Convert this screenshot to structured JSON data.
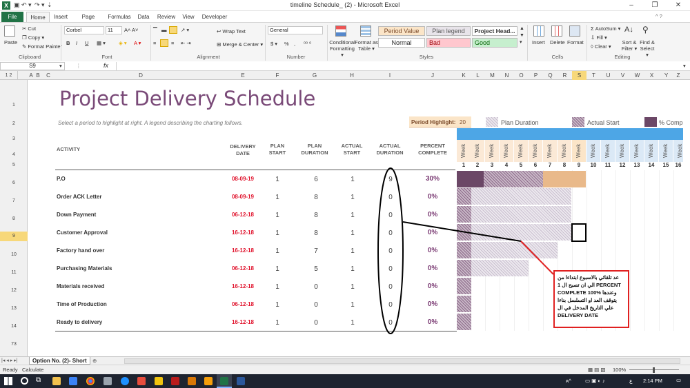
{
  "window": {
    "title": "timeline Schedule_ (2)  -  Microsoft Excel",
    "app_logo": "X",
    "controls": [
      "–",
      "❐",
      "✕"
    ],
    "ribbon_min": "^ ?"
  },
  "tabs": [
    "File",
    "Home",
    "Insert",
    "Page Layout",
    "Formulas",
    "Data",
    "Review",
    "View",
    "Developer"
  ],
  "ribbon": {
    "clipboard": {
      "paste": "Paste",
      "cut": "Cut",
      "copy": "Copy ▾",
      "format_painter": "Format Painter",
      "group": "Clipboard"
    },
    "font": {
      "name": "Corbel",
      "size": "11",
      "bold": "B",
      "italic": "I",
      "underline": "U",
      "group": "Font"
    },
    "alignment": {
      "wrap": "Wrap Text",
      "merge": "Merge & Center ▾",
      "group": "Alignment"
    },
    "number": {
      "format": "General",
      "currency": "$ ▾",
      "percent": "%",
      "comma": ",",
      "group": "Number"
    },
    "styles": {
      "conditional": "Conditional Formatting ▾",
      "format_table": "Format as Table ▾",
      "cells": [
        "Period Value",
        "Plan legend",
        "Project Head...",
        "Normal",
        "Bad",
        "Good"
      ],
      "group": "Styles"
    },
    "cells": {
      "insert": "Insert",
      "delete": "Delete",
      "format": "Format",
      "group": "Cells"
    },
    "editing": {
      "autosum": "AutoSum ▾",
      "fill": "Fill ▾",
      "clear": "Clear ▾",
      "sort": "Sort & Filter ▾",
      "find": "Find & Select ▾",
      "group": "Editing"
    }
  },
  "formula_bar": {
    "name_box": "S9",
    "fx": "fx",
    "content": ""
  },
  "columns": [
    "A",
    "B",
    "C",
    "D",
    "E",
    "F",
    "G",
    "H",
    "I",
    "J",
    "K",
    "L",
    "M",
    "N",
    "O",
    "P",
    "Q",
    "R",
    "S",
    "T",
    "U",
    "V",
    "W",
    "X",
    "Y",
    "Z"
  ],
  "outline_levels": [
    "1",
    "2"
  ],
  "rows": [
    "1",
    "2",
    "3",
    "4",
    "5",
    "6",
    "7",
    "8",
    "9",
    "10",
    "11",
    "12",
    "13",
    "14",
    "73"
  ],
  "sheet": {
    "title": "Project Delivery Schedule",
    "subtitle": "Select a period to highlight at right.  A legend describing the charting follows.",
    "period_highlight_label": "Period Highlight:",
    "period_highlight_value": "20",
    "legend": [
      "Plan Duration",
      "Actual Start",
      "% Comp"
    ],
    "headers": {
      "activity": "ACTIVITY",
      "delivery_date": "DELIVERY DATE",
      "plan_start": "PLAN START",
      "plan_duration": "PLAN DURATION",
      "actual_start": "ACTUAL START",
      "actual_duration": "ACTUAL DURATION",
      "percent_complete": "PERCENT COMPLETE"
    },
    "week_label": "Week",
    "weeks": [
      "1",
      "2",
      "3",
      "4",
      "5",
      "6",
      "7",
      "8",
      "9",
      "10",
      "11",
      "12",
      "13",
      "14",
      "15",
      "16"
    ],
    "rows": [
      {
        "activity": "P.O",
        "date": "08-09-19",
        "plan_start": "1",
        "plan_duration": "6",
        "actual_start": "1",
        "actual_duration": "9",
        "percent": "30%"
      },
      {
        "activity": "Order ACK Letter",
        "date": "08-09-19",
        "plan_start": "1",
        "plan_duration": "8",
        "actual_start": "1",
        "actual_duration": "0",
        "percent": "0%"
      },
      {
        "activity": "Down Payment",
        "date": "06-12-18",
        "plan_start": "1",
        "plan_duration": "8",
        "actual_start": "1",
        "actual_duration": "0",
        "percent": "0%"
      },
      {
        "activity": "Customer Approval",
        "date": "16-12-18",
        "plan_start": "1",
        "plan_duration": "8",
        "actual_start": "1",
        "actual_duration": "0",
        "percent": "0%"
      },
      {
        "activity": "Factory hand over",
        "date": "16-12-18",
        "plan_start": "1",
        "plan_duration": "7",
        "actual_start": "1",
        "actual_duration": "0",
        "percent": "0%"
      },
      {
        "activity": "Purchasing Materials",
        "date": "06-12-18",
        "plan_start": "1",
        "plan_duration": "5",
        "actual_start": "1",
        "actual_duration": "0",
        "percent": "0%"
      },
      {
        "activity": "Materials received",
        "date": "16-12-18",
        "plan_start": "1",
        "plan_duration": "0",
        "actual_start": "1",
        "actual_duration": "0",
        "percent": "0%"
      },
      {
        "activity": "Time of Production",
        "date": "06-12-18",
        "plan_start": "1",
        "plan_duration": "0",
        "actual_start": "1",
        "actual_duration": "0",
        "percent": "0%"
      },
      {
        "activity": "Ready to delivery",
        "date": "16-12-18",
        "plan_start": "1",
        "plan_duration": "0",
        "actual_start": "1",
        "actual_duration": "0",
        "percent": "0%"
      }
    ],
    "note_lines": [
      "عد تلقائي بالاسبوع ابتداءا من",
      "1 الي ان تصبح ال PERCENT",
      "COMPLETE 100% وعندها",
      "يتوقف العد او التسلسل بناءا",
      "علي التاريخ المدخل في ال",
      "DELIVERY DATE"
    ]
  },
  "sheet_tab": "Option No. (2)- Short",
  "status": {
    "ready": "Ready",
    "calculate": "Calculate",
    "zoom": "100%"
  },
  "taskbar": {
    "time": "2:14 PM",
    "lang": "ع"
  },
  "colors": {
    "accent": "#217346",
    "title": "#7a4a78",
    "week_bar": "#4da6e6",
    "note_border": "#e02020"
  }
}
